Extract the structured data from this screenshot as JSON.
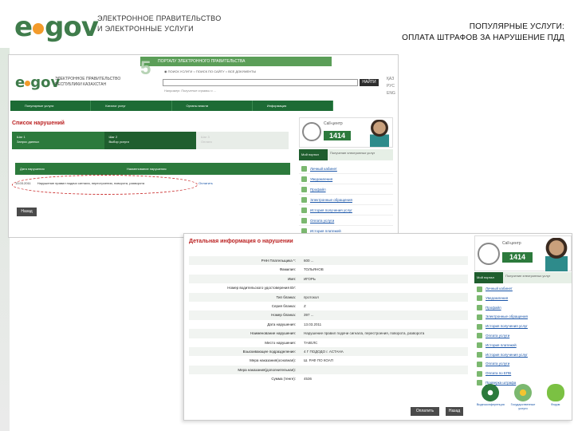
{
  "header": {
    "logo_e": "e",
    "logo_gov": "gov",
    "subtitle_1": "ЭЛЕКТРОННОЕ ПРАВИТЕЛЬСТВО",
    "subtitle_2": "И ЭЛЕКТРОННЫЕ УСЛУГИ",
    "title_1": "ПОПУЛЯРНЫЕ УСЛУГИ:",
    "title_2": "ОПЛАТА ШТРАФОВ ЗА НАРУШЕНИЕ ПДД"
  },
  "shot1": {
    "banner": "ПОРТАЛУ ЭЛЕКТРОННОГО ПРАВИТЕЛЬСТВА",
    "years": "5",
    "logo_e": "e",
    "logo_gov": "gov",
    "logo_sub_1": "ЭЛЕКТРОННОЕ ПРАВИТЕЛЬСТВО",
    "logo_sub_2": "РЕСПУБЛИКИ КАЗАХСТАН",
    "search_options": "◉ ПОИСК УСЛУГИ  ○ ПОИСК ПО САЙТУ  ○ ВСЕ ДОКУМЕНТЫ",
    "find_button": "НАЙТИ",
    "search_hint": "Например: Получение справки о ...",
    "langs": [
      "ҚАЗ",
      "РУС",
      "ENG"
    ],
    "nav": [
      "Популярные услуги",
      "Каталог услуг",
      "Органы власти",
      "Информация"
    ],
    "heading": "Список нарушений",
    "steps": [
      {
        "label": "Шаг 1",
        "desc": "Запрос данных"
      },
      {
        "label": "Шаг 2",
        "desc": "Выбор услуги"
      },
      {
        "label": "Шаг 3",
        "desc": "Оплата"
      }
    ],
    "table_headers": [
      "Дата нарушения",
      "Наименование нарушения"
    ],
    "row": {
      "date": "13.03.2011",
      "name": "Нарушение правил подачи сигнала, перестроения, поворота, разворота",
      "link": "Оплатить"
    },
    "back_button": "Назад"
  },
  "sidebar": {
    "cc_label": "Call-центр",
    "cc_number": "1414",
    "tab_active": "Мой портал",
    "tab_other": "Получение электронных услуг",
    "items_1": [
      "Личный кабинет",
      "Уведомления",
      "Профайл",
      "Электронные обращения",
      "История получения услуг",
      "Оплата услуги",
      "История платежей"
    ],
    "items_2": [
      "Личный кабинет",
      "Уведомления",
      "Профайл",
      "Электронные обращения",
      "История получения услуг",
      "Оплата услуги",
      "История платежей",
      "История получения услуг",
      "Оплата услуги",
      "Оплата по ЕПВ",
      "Проверка штрафа"
    ],
    "badges": [
      "Видеоконференция",
      "Государственные услуги",
      "Форум"
    ]
  },
  "shot2": {
    "heading": "Детальная информация о нарушении",
    "fields": [
      {
        "k": "РНН Плательщика *:",
        "v": "600 ..."
      },
      {
        "k": "Фамилия:",
        "v": "ТОЛЬЯНОВ"
      },
      {
        "k": "Имя:",
        "v": "ИГОРЬ"
      },
      {
        "k": "Номер водительского удостоверения ВУ:",
        "v": ""
      },
      {
        "k": "Тип бланка:",
        "v": "протокол"
      },
      {
        "k": "Серия бланка:",
        "v": "Z"
      },
      {
        "k": "Номер бланка:",
        "v": "397 ..."
      },
      {
        "k": "Дата нарушения:",
        "v": "13.03.2011"
      },
      {
        "k": "Наименование нарушения:",
        "v": "Нарушение правил подачи сигнала, перестроения, поворота, разворота"
      },
      {
        "k": "Место нарушения:",
        "v": "ТАКЕЛС"
      },
      {
        "k": "Взыскивающее подразделение:",
        "v": "4 Г ПОДОДО г. АСТАНА"
      },
      {
        "k": "Мера наказания(основная):",
        "v": "Ш. РАФ ПО КОАП"
      },
      {
        "k": "Мера наказания(дополнительная):",
        "v": ""
      },
      {
        "k": "Сумма (тенге):",
        "v": "4536"
      }
    ],
    "pay_button": "Оплатить",
    "back_button": "Назад"
  }
}
